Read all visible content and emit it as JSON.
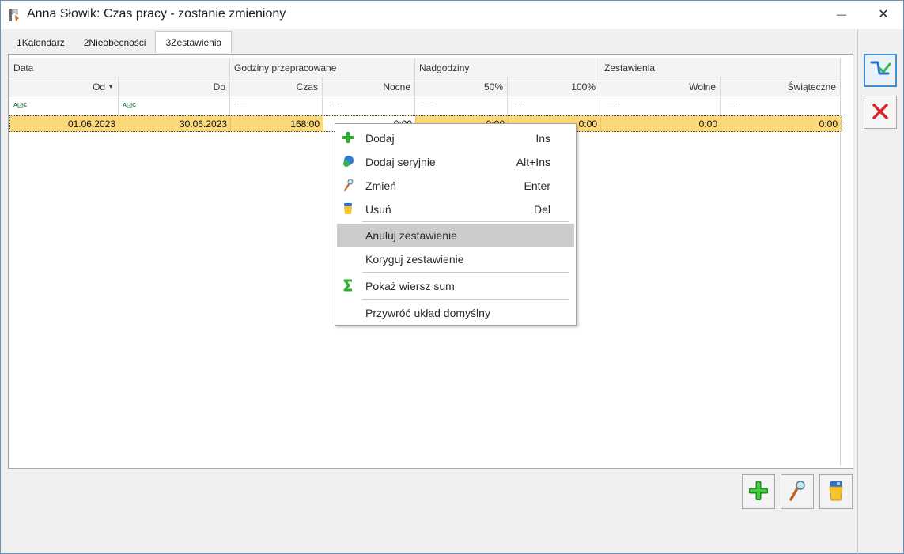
{
  "window": {
    "title": "Anna Słowik: Czas pracy - zostanie zmieniony",
    "minimize_glyph": "—",
    "close_glyph": "✕"
  },
  "tabs": [
    {
      "num": "1",
      "label": " Kalendarz",
      "active": false
    },
    {
      "num": "2",
      "label": " Nieobecności",
      "active": false
    },
    {
      "num": "3",
      "label": " Zestawienia",
      "active": true
    }
  ],
  "grid": {
    "group_headers": [
      "Data",
      "Godziny przepracowane",
      "Nadgodziny",
      "Zestawienia"
    ],
    "columns": [
      "Od",
      "Do",
      "Czas",
      "Nocne",
      "50%",
      "100%",
      "Wolne",
      "Świąteczne"
    ],
    "filter_abc": {
      "a": "A",
      "b": "B",
      "c": "C"
    },
    "rows": [
      {
        "od": "01.06.2023",
        "do": "30.06.2023",
        "czas": "168:00",
        "nocne": "0:00",
        "p50": "0:00",
        "p100": "0:00",
        "wolne": "0:00",
        "swiateczne": "0:00"
      }
    ]
  },
  "context_menu": {
    "items": [
      {
        "label": "Dodaj",
        "shortcut": "Ins",
        "icon": "plus-icon"
      },
      {
        "label": "Dodaj seryjnie",
        "shortcut": "Alt+Ins",
        "icon": "serial-add-icon"
      },
      {
        "label": "Zmień",
        "shortcut": "Enter",
        "icon": "magnifier-icon"
      },
      {
        "label": "Usuń",
        "shortcut": "Del",
        "icon": "trash-icon"
      },
      {
        "label": "Anuluj zestawienie",
        "shortcut": "",
        "icon": "",
        "highlighted": true
      },
      {
        "label": "Koryguj zestawienie",
        "shortcut": "",
        "icon": ""
      },
      {
        "label": "Pokaż wiersz sum",
        "shortcut": "",
        "icon": "sum-icon"
      },
      {
        "label": "Przywróć układ domyślny",
        "shortcut": "",
        "icon": ""
      }
    ]
  },
  "colors": {
    "selected_row": "#fbd97a",
    "menu_highlight": "#cccccc",
    "accent_blue": "#3d8fd6",
    "cancel_red": "#d9262a",
    "add_green": "#2bb12b"
  }
}
